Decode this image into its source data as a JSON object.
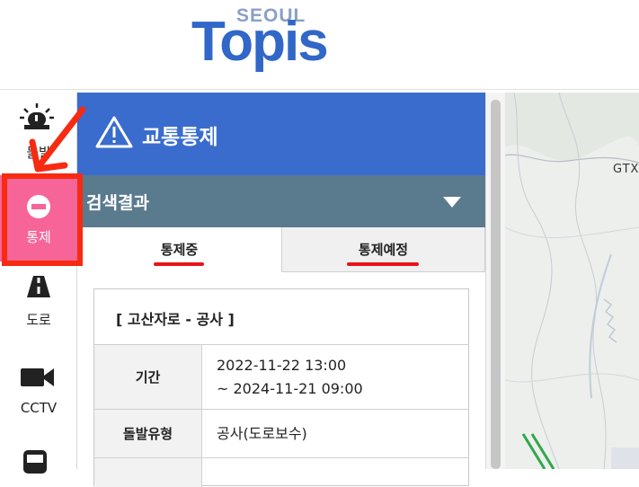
{
  "header": {
    "logo_top": "SEOUL",
    "logo_main": "Topis"
  },
  "sidebar": {
    "items": [
      {
        "label": "돌발",
        "icon": "siren-icon"
      },
      {
        "label": "통제",
        "icon": "no-entry-icon",
        "active": true
      },
      {
        "label": "도로",
        "icon": "road-icon"
      },
      {
        "label": "CCTV",
        "icon": "camera-icon"
      },
      {
        "label": "",
        "icon": "bus-icon"
      }
    ]
  },
  "panel": {
    "title": "교통통제",
    "results_label": "검색결과",
    "tabs": [
      {
        "label": "통제중",
        "active": true
      },
      {
        "label": "통제예정",
        "active": false
      }
    ],
    "card": {
      "title": "[ 고산자로 - 공사 ]",
      "rows": [
        {
          "key": "기간",
          "value_line1": "2022-11-22 13:00",
          "value_line2": "~ 2024-11-21 09:00"
        },
        {
          "key": "돌발유형",
          "value_line1": "공사(도로보수)"
        }
      ]
    }
  },
  "map": {
    "label": "GTX-"
  },
  "colors": {
    "brand_blue": "#3a6cce",
    "results_bar": "#5a7a8e",
    "active_nav": "#f76598",
    "annotation_red": "#f72a12",
    "tab_underline": "#e8141b"
  }
}
